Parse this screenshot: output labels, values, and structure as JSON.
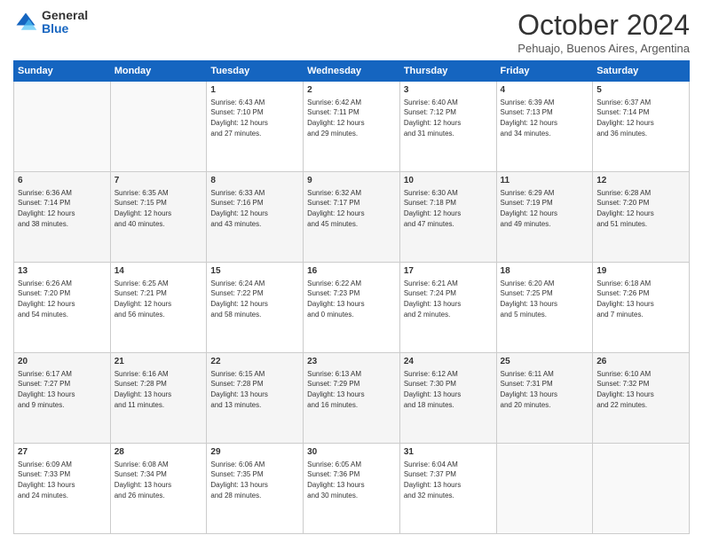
{
  "header": {
    "logo_line1": "General",
    "logo_line2": "Blue",
    "month": "October 2024",
    "location": "Pehuajo, Buenos Aires, Argentina"
  },
  "weekdays": [
    "Sunday",
    "Monday",
    "Tuesday",
    "Wednesday",
    "Thursday",
    "Friday",
    "Saturday"
  ],
  "rows": [
    [
      {
        "day": "",
        "info": ""
      },
      {
        "day": "",
        "info": ""
      },
      {
        "day": "1",
        "info": "Sunrise: 6:43 AM\nSunset: 7:10 PM\nDaylight: 12 hours\nand 27 minutes."
      },
      {
        "day": "2",
        "info": "Sunrise: 6:42 AM\nSunset: 7:11 PM\nDaylight: 12 hours\nand 29 minutes."
      },
      {
        "day": "3",
        "info": "Sunrise: 6:40 AM\nSunset: 7:12 PM\nDaylight: 12 hours\nand 31 minutes."
      },
      {
        "day": "4",
        "info": "Sunrise: 6:39 AM\nSunset: 7:13 PM\nDaylight: 12 hours\nand 34 minutes."
      },
      {
        "day": "5",
        "info": "Sunrise: 6:37 AM\nSunset: 7:14 PM\nDaylight: 12 hours\nand 36 minutes."
      }
    ],
    [
      {
        "day": "6",
        "info": "Sunrise: 6:36 AM\nSunset: 7:14 PM\nDaylight: 12 hours\nand 38 minutes."
      },
      {
        "day": "7",
        "info": "Sunrise: 6:35 AM\nSunset: 7:15 PM\nDaylight: 12 hours\nand 40 minutes."
      },
      {
        "day": "8",
        "info": "Sunrise: 6:33 AM\nSunset: 7:16 PM\nDaylight: 12 hours\nand 43 minutes."
      },
      {
        "day": "9",
        "info": "Sunrise: 6:32 AM\nSunset: 7:17 PM\nDaylight: 12 hours\nand 45 minutes."
      },
      {
        "day": "10",
        "info": "Sunrise: 6:30 AM\nSunset: 7:18 PM\nDaylight: 12 hours\nand 47 minutes."
      },
      {
        "day": "11",
        "info": "Sunrise: 6:29 AM\nSunset: 7:19 PM\nDaylight: 12 hours\nand 49 minutes."
      },
      {
        "day": "12",
        "info": "Sunrise: 6:28 AM\nSunset: 7:20 PM\nDaylight: 12 hours\nand 51 minutes."
      }
    ],
    [
      {
        "day": "13",
        "info": "Sunrise: 6:26 AM\nSunset: 7:20 PM\nDaylight: 12 hours\nand 54 minutes."
      },
      {
        "day": "14",
        "info": "Sunrise: 6:25 AM\nSunset: 7:21 PM\nDaylight: 12 hours\nand 56 minutes."
      },
      {
        "day": "15",
        "info": "Sunrise: 6:24 AM\nSunset: 7:22 PM\nDaylight: 12 hours\nand 58 minutes."
      },
      {
        "day": "16",
        "info": "Sunrise: 6:22 AM\nSunset: 7:23 PM\nDaylight: 13 hours\nand 0 minutes."
      },
      {
        "day": "17",
        "info": "Sunrise: 6:21 AM\nSunset: 7:24 PM\nDaylight: 13 hours\nand 2 minutes."
      },
      {
        "day": "18",
        "info": "Sunrise: 6:20 AM\nSunset: 7:25 PM\nDaylight: 13 hours\nand 5 minutes."
      },
      {
        "day": "19",
        "info": "Sunrise: 6:18 AM\nSunset: 7:26 PM\nDaylight: 13 hours\nand 7 minutes."
      }
    ],
    [
      {
        "day": "20",
        "info": "Sunrise: 6:17 AM\nSunset: 7:27 PM\nDaylight: 13 hours\nand 9 minutes."
      },
      {
        "day": "21",
        "info": "Sunrise: 6:16 AM\nSunset: 7:28 PM\nDaylight: 13 hours\nand 11 minutes."
      },
      {
        "day": "22",
        "info": "Sunrise: 6:15 AM\nSunset: 7:28 PM\nDaylight: 13 hours\nand 13 minutes."
      },
      {
        "day": "23",
        "info": "Sunrise: 6:13 AM\nSunset: 7:29 PM\nDaylight: 13 hours\nand 16 minutes."
      },
      {
        "day": "24",
        "info": "Sunrise: 6:12 AM\nSunset: 7:30 PM\nDaylight: 13 hours\nand 18 minutes."
      },
      {
        "day": "25",
        "info": "Sunrise: 6:11 AM\nSunset: 7:31 PM\nDaylight: 13 hours\nand 20 minutes."
      },
      {
        "day": "26",
        "info": "Sunrise: 6:10 AM\nSunset: 7:32 PM\nDaylight: 13 hours\nand 22 minutes."
      }
    ],
    [
      {
        "day": "27",
        "info": "Sunrise: 6:09 AM\nSunset: 7:33 PM\nDaylight: 13 hours\nand 24 minutes."
      },
      {
        "day": "28",
        "info": "Sunrise: 6:08 AM\nSunset: 7:34 PM\nDaylight: 13 hours\nand 26 minutes."
      },
      {
        "day": "29",
        "info": "Sunrise: 6:06 AM\nSunset: 7:35 PM\nDaylight: 13 hours\nand 28 minutes."
      },
      {
        "day": "30",
        "info": "Sunrise: 6:05 AM\nSunset: 7:36 PM\nDaylight: 13 hours\nand 30 minutes."
      },
      {
        "day": "31",
        "info": "Sunrise: 6:04 AM\nSunset: 7:37 PM\nDaylight: 13 hours\nand 32 minutes."
      },
      {
        "day": "",
        "info": ""
      },
      {
        "day": "",
        "info": ""
      }
    ]
  ]
}
